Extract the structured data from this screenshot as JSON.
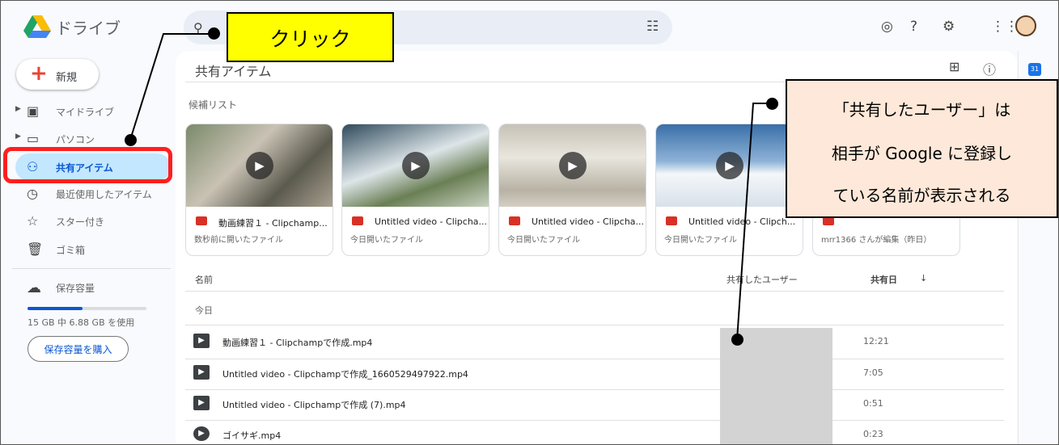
{
  "header": {
    "app_name": "ドライブ",
    "search_placeholder": ""
  },
  "sidebar": {
    "new_label": "新規",
    "items": [
      {
        "label": "マイドライブ",
        "icon": "drive-icon"
      },
      {
        "label": "パソコン",
        "icon": "computer-icon"
      },
      {
        "label": "共有アイテム",
        "icon": "people-icon",
        "active": true
      },
      {
        "label": "最近使用したアイテム",
        "icon": "clock-icon"
      },
      {
        "label": "スター付き",
        "icon": "star-icon"
      },
      {
        "label": "ゴミ箱",
        "icon": "trash-icon"
      }
    ],
    "storage_label": "保存容量",
    "storage_text": "15 GB 中 6.88 GB を使用",
    "storage_fraction": 0.46,
    "buy_label": "保存容量を購入"
  },
  "main": {
    "title": "共有アイテム",
    "suggested_label": "候補リスト",
    "cards": [
      {
        "title": "動画練習１ - Clipchamp...",
        "sub": "数秒前に開いたファイル"
      },
      {
        "title": "Untitled video - Clipcha...",
        "sub": "今日開いたファイル"
      },
      {
        "title": "Untitled video - Clipcha...",
        "sub": "今日開いたファイル"
      },
      {
        "title": "Untitled video - Clipch...",
        "sub": "今日開いたファイル"
      },
      {
        "title": "",
        "sub": "mrr1366 さんが編集（昨日）"
      }
    ],
    "columns": {
      "name": "名前",
      "shared_by": "共有したユーザー",
      "shared_date": "共有日"
    },
    "section_today": "今日",
    "files": [
      {
        "name": "動画練習１ - Clipchampで作成.mp4",
        "date": "12:21"
      },
      {
        "name": "Untitled video - Clipchampで作成_1660529497922.mp4",
        "date": "7:05"
      },
      {
        "name": "Untitled video - Clipchampで作成 (7).mp4",
        "date": "0:51"
      },
      {
        "name": "ゴイサギ.mp4",
        "date": "0:23"
      }
    ]
  },
  "annotations": {
    "click_label": "クリック",
    "callout_lines": [
      "「共有したユーザー」は",
      "相手が Google に登録し",
      "ている名前が表示される"
    ]
  }
}
